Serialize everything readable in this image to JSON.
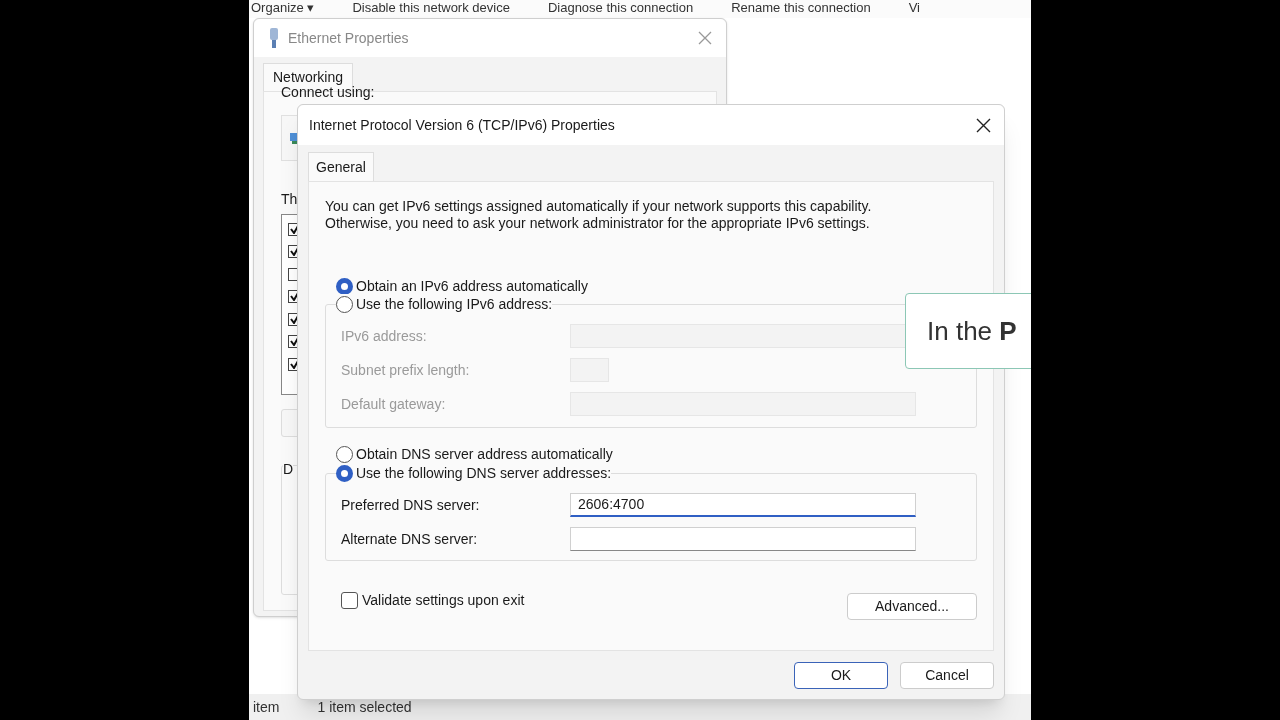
{
  "explorer": {
    "toolbar": [
      "Organize ▾",
      "Disable this network device",
      "Diagnose this connection",
      "Rename this connection",
      "Vi"
    ],
    "status_bar": [
      "item",
      "1 item selected"
    ]
  },
  "ethernet_dialog": {
    "title": "Ethernet Properties",
    "tabs": [
      {
        "label": "Networking",
        "selected": true
      }
    ],
    "connect_label": "Connect using:",
    "items_label": "Th",
    "items": [
      {
        "checked": true
      },
      {
        "checked": true
      },
      {
        "checked": false
      },
      {
        "checked": true
      },
      {
        "checked": true
      },
      {
        "checked": true
      },
      {
        "checked": true
      }
    ],
    "group_label": "D"
  },
  "ipv6_dialog": {
    "title": "Internet Protocol Version 6 (TCP/IPv6) Properties",
    "tabs": [
      {
        "label": "General",
        "selected": true
      }
    ],
    "intro": "You can get IPv6 settings assigned automatically if your network supports this capability.\nOtherwise, you need to ask your network administrator for the appropriate IPv6 settings.",
    "address_options": [
      {
        "label": "Obtain an IPv6 address automatically",
        "selected": true
      },
      {
        "label": "Use the following IPv6 address:",
        "selected": false
      }
    ],
    "address_fields": [
      {
        "label": "IPv6 address:",
        "kind": "wide",
        "disabled": true
      },
      {
        "label": "Subnet prefix length:",
        "kind": "short",
        "disabled": true
      },
      {
        "label": "Default gateway:",
        "kind": "wide",
        "disabled": true
      }
    ],
    "dns_options": [
      {
        "label": "Obtain DNS server address automatically",
        "selected": false
      },
      {
        "label": "Use the following DNS server addresses:",
        "selected": true
      }
    ],
    "dns_fields": [
      {
        "label": "Preferred DNS server:",
        "value": "2606:4700",
        "focused": true,
        "disabled": false
      },
      {
        "label": "Alternate DNS server:",
        "focused": false,
        "disabled": false
      }
    ],
    "validate": {
      "label": "Validate settings upon exit",
      "checked": false
    },
    "advanced_button": "Advanced...",
    "buttons": [
      {
        "label": "OK",
        "default": true
      },
      {
        "label": "Cancel",
        "default": false
      }
    ]
  },
  "tooltip": {
    "text": "In the **P**"
  }
}
